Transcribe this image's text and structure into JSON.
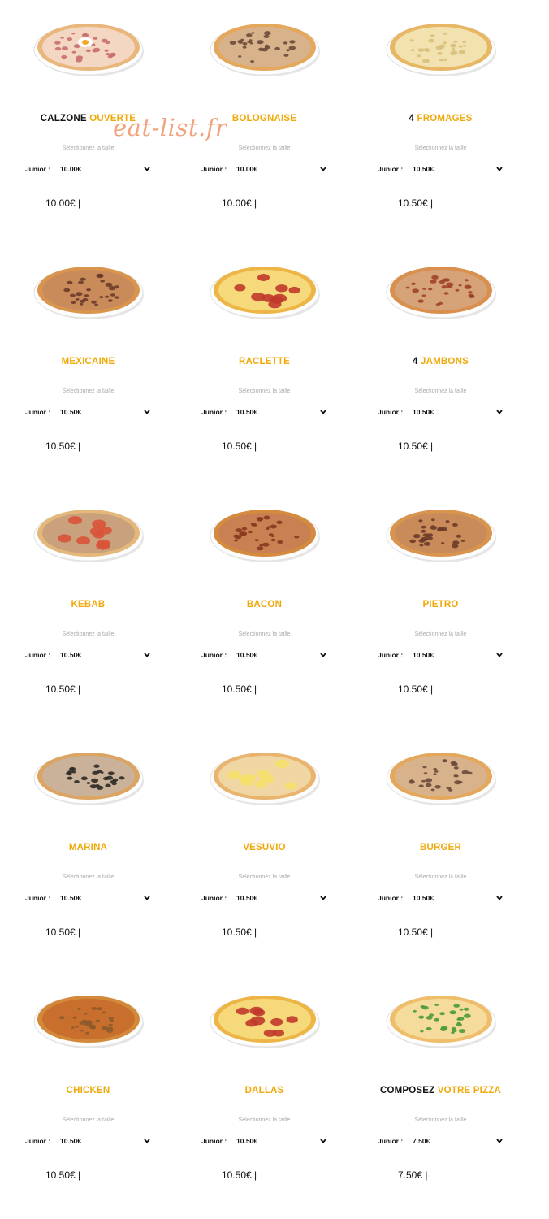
{
  "watermark": "eat-list.fr",
  "colors": {
    "accent": "#f0a90a",
    "text": "#111111",
    "muted": "#aaaaaa",
    "watermark": "#f1a37d"
  },
  "size_hint": "Sélectionnez la taille",
  "products": [
    {
      "title_dark": "CALZONE",
      "title_accent": "OUVERTE",
      "size": "Junior :",
      "size_price": "10.00€",
      "price": "10.00€ |",
      "toppings": "egg"
    },
    {
      "title_dark": "",
      "title_accent": "BOLOGNAISE",
      "size": "Junior :",
      "size_price": "10.00€",
      "price": "10.00€ |",
      "toppings": "mince"
    },
    {
      "title_dark": "4",
      "title_accent": "FROMAGES",
      "size": "Junior :",
      "size_price": "10.50€",
      "price": "10.50€ |",
      "toppings": "cheese"
    },
    {
      "title_dark": "",
      "title_accent": "MEXICAINE",
      "size": "Junior :",
      "size_price": "10.50€",
      "price": "10.50€ |",
      "toppings": "meat"
    },
    {
      "title_dark": "",
      "title_accent": "RACLETTE",
      "size": "Junior :",
      "size_price": "10.50€",
      "price": "10.50€ |",
      "toppings": "pepperoni"
    },
    {
      "title_dark": "4",
      "title_accent": "JAMBONS",
      "size": "Junior :",
      "size_price": "10.50€",
      "price": "10.50€ |",
      "toppings": "ham"
    },
    {
      "title_dark": "",
      "title_accent": "KEBAB",
      "size": "Junior :",
      "size_price": "10.50€",
      "price": "10.50€ |",
      "toppings": "tomato"
    },
    {
      "title_dark": "",
      "title_accent": "BACON",
      "size": "Junior :",
      "size_price": "10.50€",
      "price": "10.50€ |",
      "toppings": "bacon"
    },
    {
      "title_dark": "",
      "title_accent": "PIETRO",
      "size": "Junior :",
      "size_price": "10.50€",
      "price": "10.50€ |",
      "toppings": "meat"
    },
    {
      "title_dark": "",
      "title_accent": "MARINA",
      "size": "Junior :",
      "size_price": "10.50€",
      "price": "10.50€ |",
      "toppings": "olive"
    },
    {
      "title_dark": "",
      "title_accent": "VESUVIO",
      "size": "Junior :",
      "size_price": "10.50€",
      "price": "10.50€ |",
      "toppings": "pineapple"
    },
    {
      "title_dark": "",
      "title_accent": "BURGER",
      "size": "Junior :",
      "size_price": "10.50€",
      "price": "10.50€ |",
      "toppings": "mince"
    },
    {
      "title_dark": "",
      "title_accent": "CHICKEN",
      "size": "Junior :",
      "size_price": "10.50€",
      "price": "10.50€ |",
      "toppings": "chicken"
    },
    {
      "title_dark": "",
      "title_accent": "DALLAS",
      "size": "Junior :",
      "size_price": "10.50€",
      "price": "10.50€ |",
      "toppings": "pepperoni"
    },
    {
      "title_dark": "COMPOSEZ",
      "title_accent": "VOTRE PIZZA",
      "size": "Junior :",
      "size_price": "7.50€",
      "price": "7.50€ |",
      "toppings": "basil"
    }
  ]
}
